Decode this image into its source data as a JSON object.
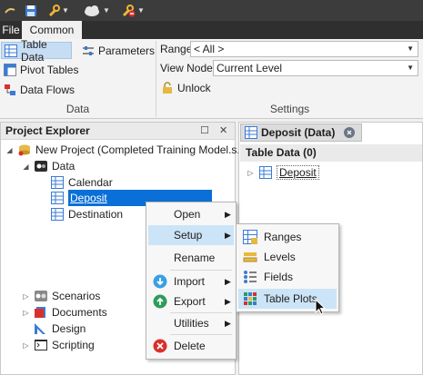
{
  "menubar": {
    "file_tab": "File",
    "common_tab": "Common"
  },
  "ribbon": {
    "data_group": {
      "table_data": "Table Data",
      "parameters": "Parameters",
      "pivot_tables": "Pivot Tables",
      "data_flows": "Data Flows",
      "label": "Data"
    },
    "settings_group": {
      "range_label": "Range",
      "range_value": "< All >",
      "view_nodes_label": "View Nodes",
      "view_nodes_value": "Current Level",
      "unlock": "Unlock",
      "label": "Settings"
    }
  },
  "project_explorer": {
    "title": "Project Explorer",
    "tree": {
      "project": "New Project (Completed Training Model.s...",
      "data": "Data",
      "calendar": "Calendar",
      "deposit": "Deposit",
      "destination": "Destination",
      "scenarios": "Scenarios",
      "documents": "Documents",
      "design": "Design",
      "scripting": "Scripting"
    }
  },
  "document": {
    "tab_title": "Deposit (Data)",
    "table_header": "Table Data (0)",
    "row_label": "Deposit"
  },
  "context_menu": {
    "open": "Open",
    "setup": "Setup",
    "rename": "Rename",
    "import": "Import",
    "export": "Export",
    "utilities": "Utilities",
    "delete": "Delete"
  },
  "setup_submenu": {
    "ranges": "Ranges",
    "levels": "Levels",
    "fields": "Fields",
    "table_plots": "Table Plots"
  },
  "colors": {
    "accent": "#0a6fd6",
    "highlight": "#cce4f7",
    "dark_bar": "#3c3c3c"
  }
}
